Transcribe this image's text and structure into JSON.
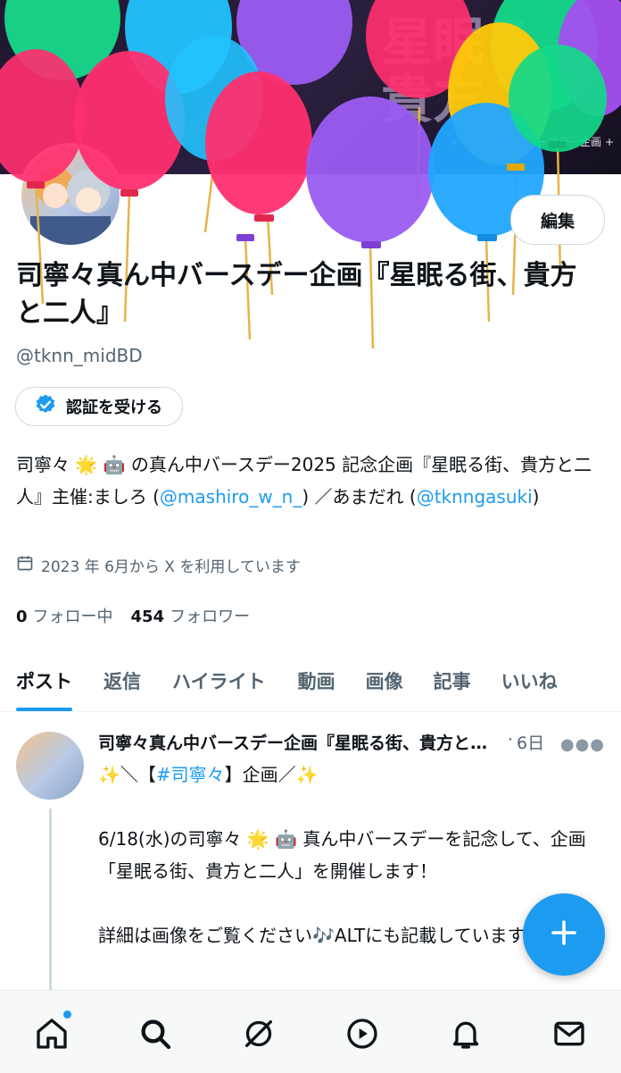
{
  "banner": {
    "deco_text": "星眠る\n貴方",
    "subtitle": "+ 司寧々真ん中バースデー企画 +"
  },
  "profile": {
    "edit_label": "編集",
    "name": "司寧々真ん中バースデー企画『星眠る街、貴方と二人』",
    "handle": "@tknn_midBD",
    "verify_label": "認証を受ける",
    "bio": {
      "part1": "司寧々 🌟 🤖 の真ん中バースデー2025 記念企画『星眠る街、貴方と二人』主催:ましろ (",
      "link1": "@mashiro_w_n_",
      "part2": ") ／あまだれ (",
      "link2": "@tknngasuki",
      "part3": ")"
    },
    "joined": "2023 年 6月から X を利用しています",
    "following_count": "0",
    "following_label": "フォロー中",
    "followers_count": "454",
    "followers_label": "フォロワー"
  },
  "tabs": [
    "ポスト",
    "返信",
    "ハイライト",
    "動画",
    "画像",
    "記事",
    "いいね"
  ],
  "post": {
    "author": "司寧々真ん中バースデー企画『星眠る街、貴方と二人』",
    "dot": "·",
    "time": "6日",
    "line1_pre": "✨＼【",
    "hashtag": "#司寧々",
    "line1_post": "】企画／✨",
    "body": "6/18(水)の司寧々 🌟 🤖 真ん中バースデーを記念して、企画「星眠る街、貴方と二人」を開催します！\n\n詳細は画像をご覧ください🎶ALTにも記載しています。"
  },
  "nav": [
    "home-icon",
    "search-icon",
    "grok-icon",
    "video-icon",
    "bell-icon",
    "mail-icon"
  ],
  "colors": {
    "accent": "#1d9bf0",
    "text": "#0f1419",
    "muted": "#536471"
  }
}
